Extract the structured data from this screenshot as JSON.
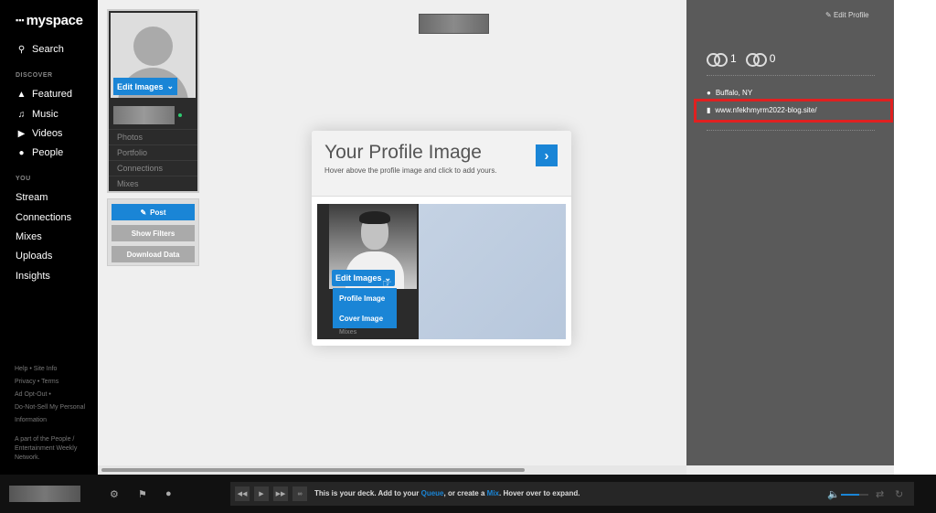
{
  "brand": {
    "name": "myspace",
    "dots": "▪▪▪"
  },
  "sidebar": {
    "search": "Search",
    "discover_heading": "DISCOVER",
    "discover": [
      {
        "label": "Featured",
        "icon": "flame-icon"
      },
      {
        "label": "Music",
        "icon": "music-note-icon"
      },
      {
        "label": "Videos",
        "icon": "video-icon"
      },
      {
        "label": "People",
        "icon": "people-icon"
      }
    ],
    "you_heading": "YOU",
    "you": [
      "Stream",
      "Connections",
      "Mixes",
      "Uploads",
      "Insights"
    ],
    "footer": {
      "help": "Help",
      "site_info": "Site Info",
      "privacy": "Privacy",
      "terms": "Terms",
      "ad_opt_out": "Ad Opt-Out",
      "do_not_sell": "Do-Not-Sell My Personal Information",
      "network": "A part of the People / Entertainment Weekly Network."
    }
  },
  "profile_card": {
    "edit_images": "Edit Images",
    "links": [
      "Photos",
      "Portfolio",
      "Connections",
      "Mixes"
    ]
  },
  "actions": {
    "post": "Post",
    "show_filters": "Show Filters",
    "download": "Download Data"
  },
  "modal": {
    "title": "Your Profile Image",
    "description": "Hover above the profile image and click to add yours.",
    "demo_edit": "Edit Images",
    "demo_profile": "Profile Image",
    "demo_cover": "Cover Image",
    "demo_mixes": "Mixes"
  },
  "right_panel": {
    "edit_profile": "Edit Profile",
    "connections_in": "1",
    "connections_out": "0",
    "location": "Buffalo, NY",
    "website": "www.nfekhmyrm2022-blog.site/"
  },
  "deck": {
    "text_before": "This is your deck. Add to your ",
    "queue": "Queue",
    "text_mid": ", or create a ",
    "mix": "Mix",
    "text_after": ". Hover over to expand.",
    "volume": 0.65
  },
  "colors": {
    "accent": "#1a85d6",
    "highlight": "#e02020",
    "online": "#2ecc71"
  }
}
